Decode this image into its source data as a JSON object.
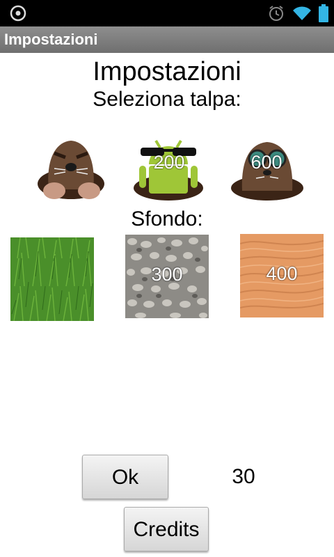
{
  "app_bar": {
    "title": "Impostazioni"
  },
  "page": {
    "heading": "Impostazioni",
    "select_mole_label": "Seleziona talpa:",
    "background_label": "Sfondo:"
  },
  "moles": [
    {
      "name": "classic-mole",
      "price": ""
    },
    {
      "name": "android-mole",
      "price": "200"
    },
    {
      "name": "goggles-mole",
      "price": "600"
    }
  ],
  "backgrounds": [
    {
      "name": "grass",
      "price": ""
    },
    {
      "name": "gravel",
      "price": "300"
    },
    {
      "name": "sand",
      "price": "400"
    }
  ],
  "buttons": {
    "ok_label": "Ok",
    "credits_label": "Credits"
  },
  "score": "30",
  "colors": {
    "title_bar": "#7a7a7a",
    "grass": "#4a8f2a",
    "gravel": "#8d8b86",
    "sand": "#e59a63",
    "android_green": "#9fc637",
    "mole_brown": "#6a4a34",
    "status_icon_blue": "#33b5e5"
  },
  "status_bar": {
    "icons": [
      "loading-icon",
      "alarm-icon",
      "wifi-icon",
      "battery-icon"
    ]
  }
}
